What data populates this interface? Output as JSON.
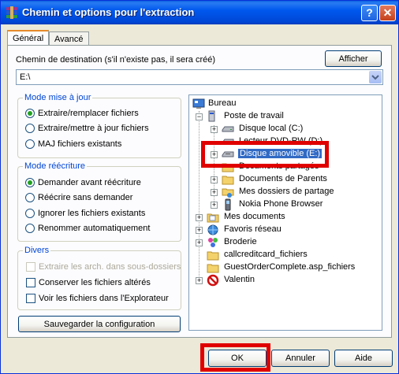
{
  "window": {
    "title": "Chemin et options pour l'extraction",
    "help_label": "?",
    "close_label": "✕",
    "icon": "winrar-icon"
  },
  "tabs": [
    {
      "label": "Général",
      "active": true
    },
    {
      "label": "Avancé",
      "active": false
    }
  ],
  "destination": {
    "label": "Chemin de destination (s'il n'existe pas, il sera créé)",
    "value": "E:\\",
    "show_button": "Afficher"
  },
  "update_mode": {
    "title": "Mode mise à jour",
    "options": [
      {
        "label": "Extraire/remplacer fichiers",
        "checked": true
      },
      {
        "label": "Extraire/mettre à jour fichiers",
        "checked": false
      },
      {
        "label": "MAJ fichiers existants",
        "checked": false
      }
    ]
  },
  "overwrite_mode": {
    "title": "Mode réécriture",
    "options": [
      {
        "label": "Demander avant réécriture",
        "checked": true
      },
      {
        "label": "Réécrire sans demander",
        "checked": false
      },
      {
        "label": "Ignorer les fichiers existants",
        "checked": false
      },
      {
        "label": "Renommer automatiquement",
        "checked": false
      }
    ]
  },
  "misc": {
    "title": "Divers",
    "options": [
      {
        "label": "Extraire les arch. dans sous-dossiers",
        "checked": false,
        "disabled": true
      },
      {
        "label": "Conserver les fichiers altérés",
        "checked": false,
        "disabled": false
      },
      {
        "label": "Voir les fichiers dans l'Explorateur",
        "checked": false,
        "disabled": false
      }
    ]
  },
  "save_config_button": "Sauvegarder la configuration",
  "tree": {
    "items": [
      {
        "label": "Bureau",
        "icon": "desktop-icon"
      },
      {
        "label": "Poste de travail",
        "icon": "computer-icon"
      },
      {
        "label": "Disque local (C:)",
        "icon": "hard-drive-icon"
      },
      {
        "label": "Lecteur DVD-RW (D:)",
        "icon": "dvd-drive-icon"
      },
      {
        "label": "Disque amovible (E:)",
        "icon": "removable-drive-icon",
        "selected": true
      },
      {
        "label": "Documents partagés",
        "icon": "folder-icon"
      },
      {
        "label": "Documents de Parents",
        "icon": "folder-icon"
      },
      {
        "label": "Mes dossiers de partage",
        "icon": "shared-folder-icon"
      },
      {
        "label": "Nokia Phone Browser",
        "icon": "phone-icon"
      },
      {
        "label": "Mes documents",
        "icon": "documents-icon"
      },
      {
        "label": "Favoris réseau",
        "icon": "network-icon"
      },
      {
        "label": "Broderie",
        "icon": "embroidery-icon"
      },
      {
        "label": "callcreditcard_fichiers",
        "icon": "folder-icon"
      },
      {
        "label": "GuestOrderComplete.asp_fichiers",
        "icon": "folder-icon"
      },
      {
        "label": "Valentin",
        "icon": "blocked-icon"
      }
    ]
  },
  "buttons": {
    "ok": "OK",
    "cancel": "Annuler",
    "help": "Aide"
  },
  "colors": {
    "titlebar": "#0058ee",
    "highlight": "#e00000",
    "selection": "#316ac5"
  }
}
